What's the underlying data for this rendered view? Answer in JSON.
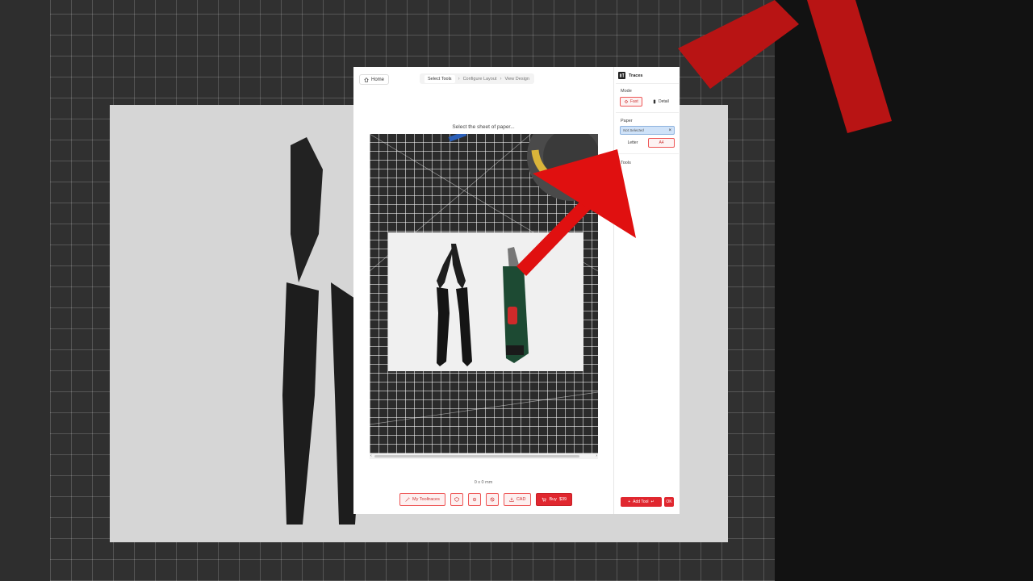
{
  "colors": {
    "accent": "#e0272f",
    "paper_selected_bg": "#cfe2f8"
  },
  "nav": {
    "home_label": "Home",
    "steps": [
      "Select Tools",
      "Configure Layout",
      "View Design"
    ],
    "active_step": "Select Tools"
  },
  "main": {
    "prompt": "Select the sheet of paper...",
    "dimensions": "0 x 0 mm",
    "actions": {
      "my_tooltraces_label": "My Tooltraces",
      "cad_label": "CAD",
      "buy_label": "Buy",
      "buy_price": "$39"
    }
  },
  "sidebar": {
    "app_title": "Traces",
    "mode_label": "Mode",
    "mode_options": [
      "Fast",
      "Detail"
    ],
    "mode_selected": "Fast",
    "paper_label": "Paper",
    "paper_value": "Not Selected",
    "paper_options": [
      "Letter",
      "A4"
    ],
    "paper_selected": "A4",
    "tools_label": "Tools",
    "add_tool_label": "Add Tool",
    "ok_label": "OK"
  },
  "icons": [
    "home-icon",
    "chevron-right-icon",
    "wand-icon",
    "gear-icon",
    "circle-slash-icon",
    "shield-icon",
    "download-icon",
    "cart-icon",
    "plus-icon",
    "enter-icon",
    "close-icon",
    "logo-icon",
    "fast-icon",
    "detail-icon"
  ]
}
